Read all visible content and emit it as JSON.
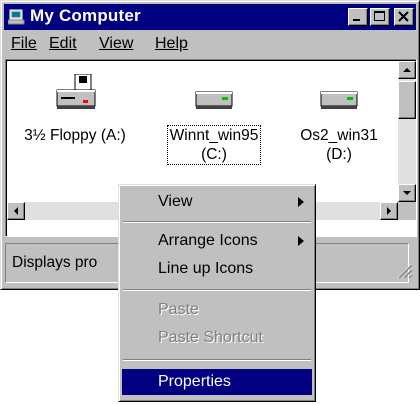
{
  "window": {
    "title": "My Computer",
    "menu": [
      {
        "label": "File"
      },
      {
        "label": "Edit"
      },
      {
        "label": "View"
      },
      {
        "label": "Help"
      }
    ]
  },
  "drives": [
    {
      "name": "3½ Floppy (A:)",
      "icon": "floppy-drive-icon",
      "selected": false
    },
    {
      "name_line1": "Winnt_win95",
      "name_line2": "(C:)",
      "icon": "hard-drive-icon",
      "selected": true
    },
    {
      "name_line1": "Os2_win31",
      "name_line2": "(D:)",
      "icon": "hard-drive-icon",
      "selected": false
    }
  ],
  "status": {
    "text": "Displays pro"
  },
  "context_menu": {
    "items": [
      {
        "label": "View",
        "submenu": true,
        "enabled": true
      },
      {
        "label": "Arrange Icons",
        "submenu": true,
        "enabled": true
      },
      {
        "label": "Line up Icons",
        "submenu": false,
        "enabled": true
      },
      {
        "label": "Paste",
        "submenu": false,
        "enabled": false
      },
      {
        "label": "Paste Shortcut",
        "submenu": false,
        "enabled": false
      },
      {
        "label": "Properties",
        "submenu": false,
        "enabled": true,
        "highlighted": true
      }
    ]
  },
  "colors": {
    "title_bar": "#000080",
    "face": "#c0c0c0",
    "highlight": "#000080",
    "window_bg": "#ffffff",
    "disabled_text": "#808080"
  }
}
